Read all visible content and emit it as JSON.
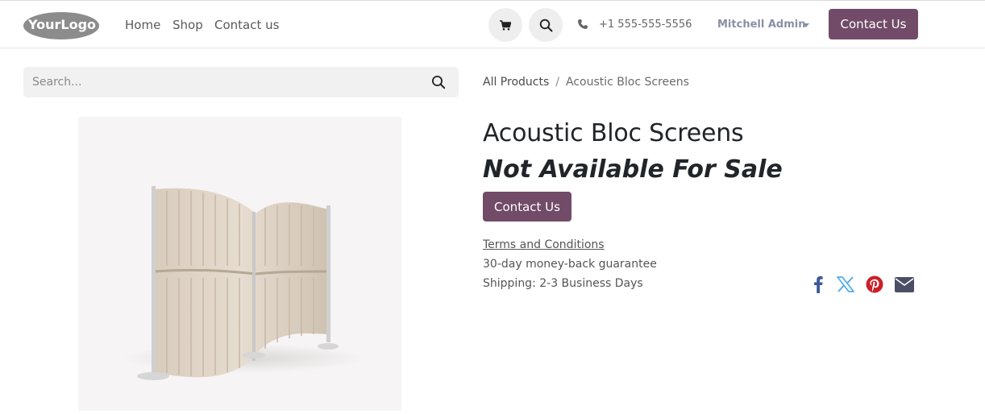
{
  "header": {
    "logo_text": "YourLogo",
    "nav": [
      "Home",
      "Shop",
      "Contact us"
    ],
    "phone": "+1 555-555-5556",
    "user": "Mitchell Admin",
    "cta_label": "Contact Us",
    "icons": [
      "cart-icon",
      "search-icon",
      "phone-icon"
    ]
  },
  "search": {
    "placeholder": "Search..."
  },
  "breadcrumb": {
    "parent": "All Products",
    "separator": "/",
    "current": "Acoustic Bloc Screens"
  },
  "product": {
    "name": "Acoustic Bloc Screens",
    "availability": "Not Available For Sale",
    "contact_label": "Contact Us",
    "terms": "Terms and Conditions",
    "guarantee": "30-day money-back guarantee",
    "shipping": "Shipping: 2-3 Business Days"
  },
  "share": [
    "facebook-icon",
    "x-icon",
    "pinterest-icon",
    "email-icon"
  ],
  "colors": {
    "primary": "#714b67",
    "facebook": "#3b5998",
    "x": "#55acee",
    "pinterest": "#cb2027",
    "email": "#4a4f66"
  }
}
